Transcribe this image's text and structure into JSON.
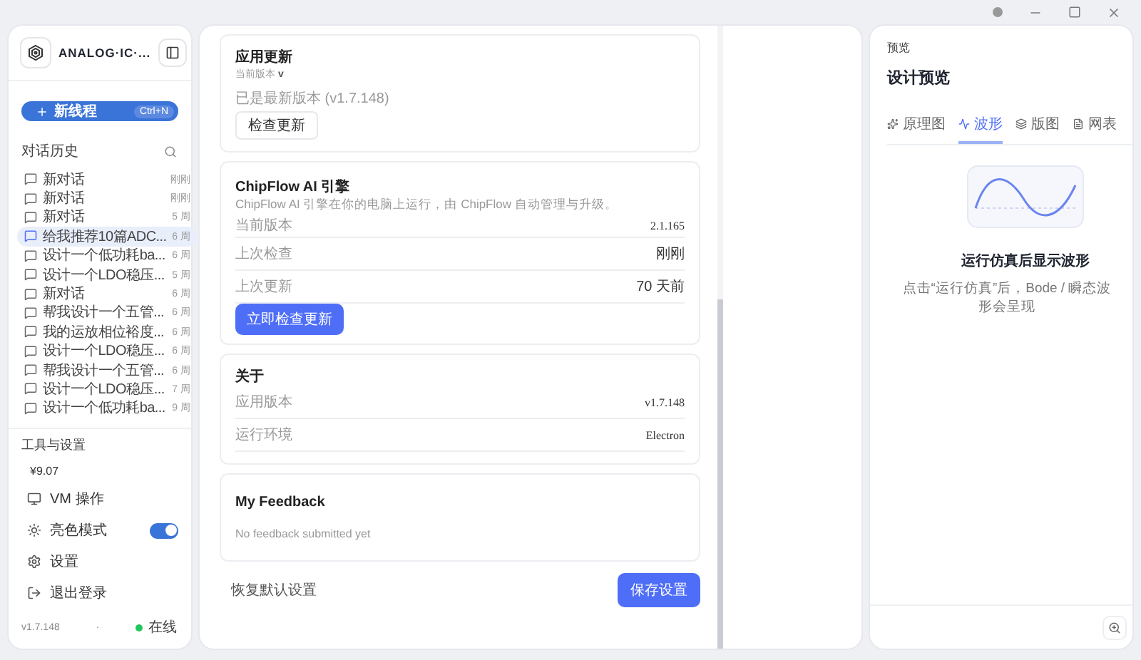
{
  "sidebar": {
    "brand": "ANALOG·IC·...",
    "new_thread": {
      "label": "新线程",
      "shortcut": "Ctrl+N"
    },
    "history_title": "对话历史",
    "history": [
      {
        "title": "新对话",
        "time": "刚刚",
        "selected": false
      },
      {
        "title": "新对话",
        "time": "刚刚",
        "selected": false
      },
      {
        "title": "新对话",
        "time": "5 周",
        "selected": false
      },
      {
        "title": "给我推荐10篇ADC...",
        "time": "6 周",
        "selected": true
      },
      {
        "title": "设计一个低功耗ba...",
        "time": "6 周",
        "selected": false
      },
      {
        "title": "设计一个LDO稳压...",
        "time": "5 周",
        "selected": false
      },
      {
        "title": "新对话",
        "time": "6 周",
        "selected": false
      },
      {
        "title": "帮我设计一个五管...",
        "time": "6 周",
        "selected": false
      },
      {
        "title": "我的运放相位裕度...",
        "time": "6 周",
        "selected": false
      },
      {
        "title": "设计一个LDO稳压...",
        "time": "6 周",
        "selected": false
      },
      {
        "title": "帮我设计一个五管...",
        "time": "6 周",
        "selected": false
      },
      {
        "title": "设计一个LDO稳压...",
        "time": "7 周",
        "selected": false
      },
      {
        "title": "设计一个低功耗ba...",
        "time": "9 周",
        "selected": false
      }
    ],
    "tools_title": "工具与设置",
    "balance": "¥9.07",
    "tools": [
      {
        "kind": "link",
        "label": "VM 操作"
      },
      {
        "kind": "toggle",
        "label": "亮色模式",
        "on": true
      },
      {
        "kind": "link",
        "label": "设置"
      },
      {
        "kind": "link",
        "label": "退出登录"
      }
    ],
    "version": "v1.7.148",
    "separator": "·",
    "status": "在线"
  },
  "settings": {
    "update": {
      "title": "应用更新",
      "current_label": "当前版本",
      "current_value": "v",
      "status": "已是最新版本 (v1.7.148)",
      "button": "检查更新"
    },
    "engine": {
      "title": "ChipFlow AI 引擎",
      "description": "ChipFlow AI 引擎在你的电脑上运行，由 ChipFlow 自动管理与升级。",
      "rows": [
        {
          "label": "当前版本",
          "value": "2.1.165"
        },
        {
          "label": "上次检查",
          "value": "刚刚"
        },
        {
          "label": "上次更新",
          "value": "70 天前"
        }
      ],
      "button": "立即检查更新"
    },
    "about": {
      "title": "关于",
      "rows": [
        {
          "label": "应用版本",
          "value": "v1.7.148"
        },
        {
          "label": "运行环境",
          "value": "Electron"
        }
      ]
    },
    "feedback": {
      "title": "My Feedback",
      "empty": "No feedback submitted yet"
    },
    "reset": "恢复默认设置",
    "save": "保存设置"
  },
  "preview": {
    "eyebrow": "预览",
    "title": "设计预览",
    "tabs": [
      {
        "label": "原理图",
        "selected": false
      },
      {
        "label": "波形",
        "selected": true
      },
      {
        "label": "版图",
        "selected": false
      },
      {
        "label": "网表",
        "selected": false
      }
    ],
    "empty_title": "运行仿真后显示波形",
    "empty_text": "点击“运行仿真”后，Bode / 瞬态波形会呈现"
  }
}
